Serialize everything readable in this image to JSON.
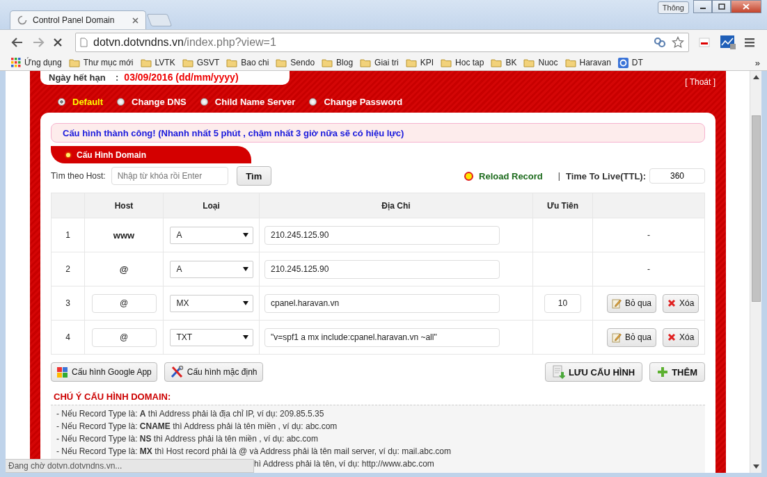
{
  "browser": {
    "tab_title": "Control Panel Domain",
    "profile_button": "Thông",
    "url_host": "dotvn.dotvndns.vn",
    "url_path": "/index.php?view=1",
    "bookmarks": [
      {
        "label": "Ứng dụng",
        "kind": "apps"
      },
      {
        "label": "Thư mục mới",
        "kind": "folder"
      },
      {
        "label": "LVTK",
        "kind": "folder"
      },
      {
        "label": "GSVT",
        "kind": "folder"
      },
      {
        "label": "Bao chi",
        "kind": "folder"
      },
      {
        "label": "Sendo",
        "kind": "folder"
      },
      {
        "label": "Blog",
        "kind": "folder"
      },
      {
        "label": "Giai tri",
        "kind": "folder"
      },
      {
        "label": "KPI",
        "kind": "folder"
      },
      {
        "label": "Hoc tap",
        "kind": "folder"
      },
      {
        "label": "BK",
        "kind": "folder"
      },
      {
        "label": "Nuoc",
        "kind": "folder"
      },
      {
        "label": "Haravan",
        "kind": "folder"
      },
      {
        "label": "DT",
        "kind": "google"
      }
    ],
    "bookmarks_overflow": "»"
  },
  "page": {
    "expiry_label": "Ngày hết hạn",
    "expiry_separator": ":",
    "expiry_value": "03/09/2016 (dd/mm/yyyy)",
    "logout": "[ Thoát ]",
    "modes": [
      {
        "label": "Default",
        "selected": true
      },
      {
        "label": "Change DNS",
        "selected": false
      },
      {
        "label": "Child Name Server",
        "selected": false
      },
      {
        "label": "Change Password",
        "selected": false
      }
    ],
    "alert": "Cấu hình thành công! (Nhanh nhất 5 phút , chậm nhất 3 giờ nữa sẽ có hiệu lực)",
    "section_title": "Cấu Hình Domain",
    "search": {
      "label": "Tìm theo Host:",
      "placeholder": "Nhập từ khóa rồi Enter",
      "button": "Tìm"
    },
    "reload": {
      "label": "Reload Record",
      "selected": true
    },
    "ttl_separator": "|",
    "ttl": {
      "label": "Time To Live(TTL):",
      "value": "360"
    },
    "table": {
      "columns": [
        "Host",
        "Loại",
        "Địa Chi",
        "Ưu Tiên"
      ],
      "rows": [
        {
          "index": "1",
          "kind": "fixed",
          "host": "www",
          "type": "A",
          "address": "210.245.125.90",
          "action": "-"
        },
        {
          "index": "2",
          "kind": "fixed",
          "host": "@",
          "type": "A",
          "address": "210.245.125.90",
          "action": "-"
        },
        {
          "index": "3",
          "kind": "editable",
          "host": "@",
          "type": "MX",
          "address": "cpanel.haravan.vn",
          "priority": "10",
          "skip": "Bỏ qua",
          "delete": "Xóa"
        },
        {
          "index": "4",
          "kind": "editable",
          "host": "@",
          "type": "TXT",
          "address": "\"v=spf1 a mx include:cpanel.haravan.vn ~all\"",
          "skip": "Bỏ qua",
          "delete": "Xóa"
        }
      ]
    },
    "buttons_left": [
      {
        "label": "Cấu hình Google App",
        "kind": "google"
      },
      {
        "label": "Cấu hình mặc định",
        "kind": "tools"
      }
    ],
    "buttons_right": [
      {
        "label": "LƯU CẤU HÌNH",
        "kind": "save"
      },
      {
        "label": "THÊM",
        "kind": "add"
      }
    ],
    "notes_title": "CHÚ Ý CẤU HÌNH DOMAIN:",
    "notes": [
      "-  Nếu Record Type là: **A** thì Address phải là địa chỉ IP, ví dụ: 209.85.5.35",
      "-  Nếu Record Type là: **CNAME** thì Address phải là tên miền , ví dụ: abc.com",
      "-  Nếu Record Type là: **NS** thì Address phải là tên miền , ví dụ: abc.com",
      "-  Nếu Record Type là: **MX** thì Host record phải là @ và Address phải là tên mail server, ví dụ: mail.abc.com"
    ],
    "notes_partial": "hì Address phải là tên, ví dụ: http://www.abc.com"
  },
  "status_bar": "Đang chờ dotvn.dotvndns.vn..."
}
